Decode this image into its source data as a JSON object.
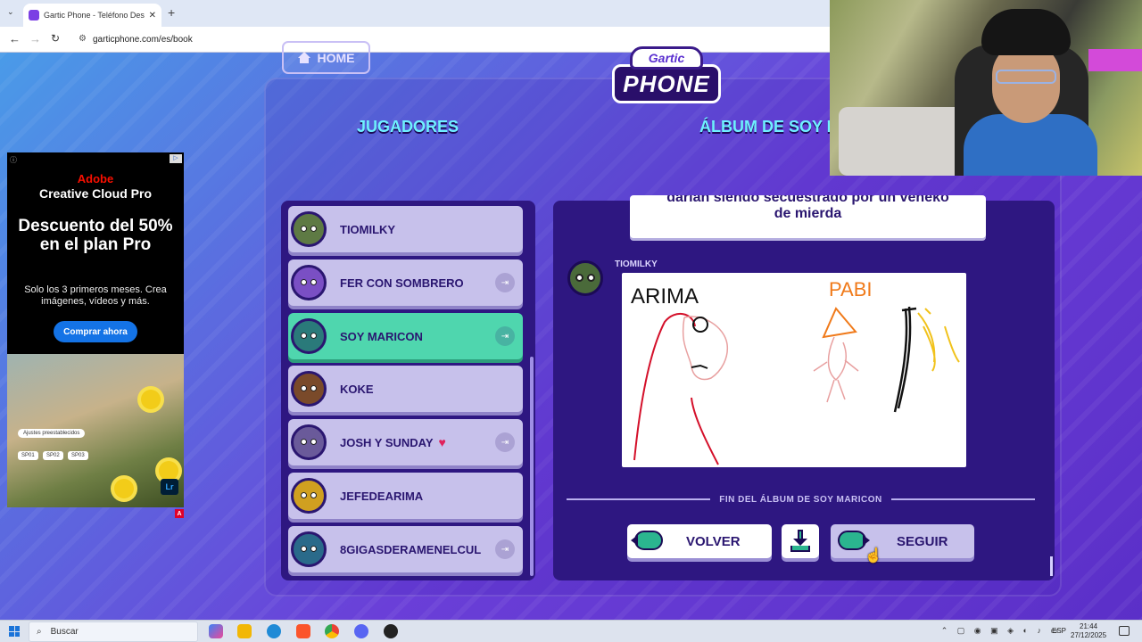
{
  "browser": {
    "tab_title": "Gartic Phone - Teléfono Descon",
    "tab_close": "✕",
    "new_tab": "+",
    "url": "garticphone.com/es/book"
  },
  "ad": {
    "brand": "Adobe",
    "product": "Creative Cloud Pro",
    "headline": "Descuento del 50% en el plan Pro",
    "sub": "Solo los 3 primeros meses. Crea imágenes, vídeos y más.",
    "cta": "Comprar ahora",
    "presets_label": "Ajustes preestablecidos",
    "chips": [
      "SP01",
      "SP02",
      "SP03"
    ],
    "app_badge": "Lr",
    "ad_mark": "A"
  },
  "game": {
    "home_label": "HOME",
    "logo_top": "Gartic",
    "logo_main": "PHONE",
    "players_heading": "JUGADORES",
    "album_heading": "ÁLBUM DE SOY MARICON",
    "players": [
      {
        "name": "TIOMILKY",
        "avatar_color": "#5e7a44",
        "kick": false,
        "heart": "",
        "active": false
      },
      {
        "name": "FER CON SOMBRERO",
        "avatar_color": "#7a4fc4",
        "kick": true,
        "heart": "",
        "active": false
      },
      {
        "name": "SOY MARICON",
        "avatar_color": "#2a7a7a",
        "kick": true,
        "heart": "",
        "active": true
      },
      {
        "name": "KOKE",
        "avatar_color": "#7a4a2a",
        "kick": false,
        "heart": "",
        "active": false
      },
      {
        "name": "JOSH Y SUNDAY",
        "avatar_color": "#6a5a9a",
        "kick": true,
        "heart": "♥",
        "active": false
      },
      {
        "name": "JEFEDEARIMA",
        "avatar_color": "#d0a020",
        "kick": false,
        "heart": "",
        "active": false
      },
      {
        "name": "8GIGASDERAMENELCUL",
        "avatar_color": "#2a6a8a",
        "kick": true,
        "heart": "",
        "active": false
      }
    ],
    "caption_line1": "darían siendo secuestrado por un veneko",
    "caption_line2": "de mierda",
    "drawer_name": "TIOMILKY",
    "drawing_words": [
      "ARIMA",
      "PABI"
    ],
    "album_end": "FIN DEL ÁLBUM DE SOY MARICON",
    "back_label": "VOLVER",
    "next_label": "SEGUIR"
  },
  "taskbar": {
    "search_placeholder": "Buscar",
    "lang": "ESP",
    "time": "21:44",
    "date": "27/12/2025"
  }
}
